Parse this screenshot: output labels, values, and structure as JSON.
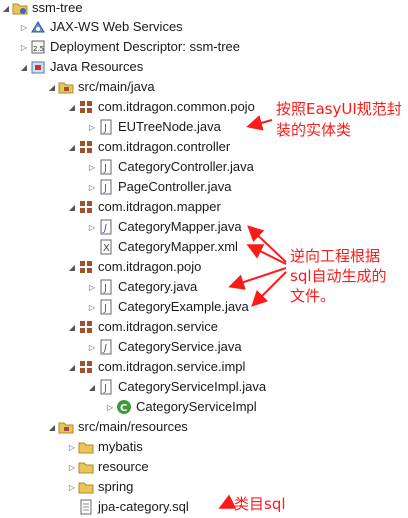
{
  "tree": {
    "project": "ssm-tree",
    "jaxws": "JAX-WS Web Services",
    "deployment": "Deployment Descriptor: ssm-tree",
    "java_resources": "Java Resources",
    "src_main_java": "src/main/java",
    "pkg_common_pojo": "com.itdragon.common.pojo",
    "eutreenode": "EUTreeNode.java",
    "pkg_controller": "com.itdragon.controller",
    "category_controller": "CategoryController.java",
    "page_controller": "PageController.java",
    "pkg_mapper": "com.itdragon.mapper",
    "category_mapper_java": "CategoryMapper.java",
    "category_mapper_xml": "CategoryMapper.xml",
    "pkg_pojo": "com.itdragon.pojo",
    "category_java": "Category.java",
    "category_example": "CategoryExample.java",
    "pkg_service": "com.itdragon.service",
    "category_service": "CategoryService.java",
    "pkg_service_impl": "com.itdragon.service.impl",
    "category_service_impl_java": "CategoryServiceImpl.java",
    "category_service_impl_class": "CategoryServiceImpl",
    "src_main_resources": "src/main/resources",
    "mybatis": "mybatis",
    "resource": "resource",
    "spring": "spring",
    "jpa_sql": "jpa-category.sql"
  },
  "annotations": {
    "easyui_line1": "按照EasyUI规范封",
    "easyui_line2": "装的实体类",
    "reverse_line1": "逆向工程根据",
    "reverse_line2": "sql自动生成的",
    "reverse_line3": "文件。",
    "sql_note": "类目sql"
  },
  "colors": {
    "annotation": "#ff1a1a",
    "package": "#a0522d",
    "folder": "#e8c45a",
    "java_file": "#3b6bb5",
    "class_icon": "#3c9a3c"
  },
  "icons": {
    "expanded": "triangle-down-icon",
    "collapsed": "triangle-right-icon"
  }
}
